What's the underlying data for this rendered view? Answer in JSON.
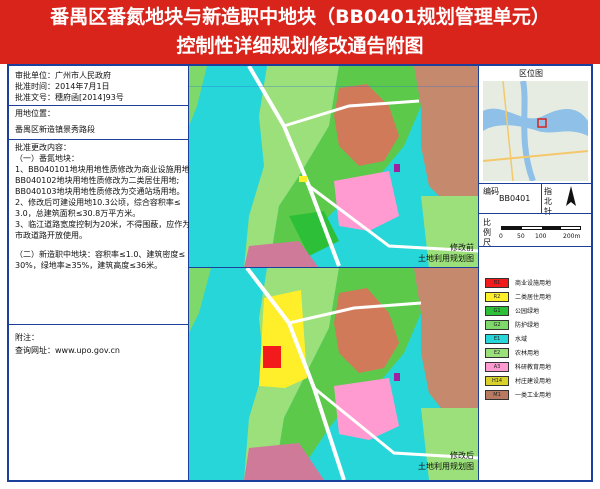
{
  "header": {
    "title_line1": "番禺区番氮地块与新造职中地块（BB0401规划管理单元）",
    "title_line2": "控制性详细规划修改通告附图"
  },
  "approval": {
    "unit": "审批单位：广州市人民政府",
    "date": "批准时间：2014年7月1日",
    "doc": "批准文号：穗府函[2014]93号"
  },
  "location": {
    "label": "用地位置：",
    "value": "番禺区新造镇景秀路段"
  },
  "changes": {
    "heading": "批准更改内容：",
    "sub1": "（一）番氮地块：",
    "lines": [
      "1、BB040101地块用地性质修改为商业设施用地;",
      "BB040102地块用地性质修改为二类居住用地;",
      "BB040103地块用地性质修改为交通站场用地。",
      "2、修改后可建设用地10.3公顷，综合容积率≤",
      "3.0，总建筑面积≤30.8万平方米。",
      "3、临江道路宽度控制为20米，不得围蔽，应作为",
      "市政道路开放使用。"
    ],
    "sub2_lines": [
      "（二）新造职中地块：容积率≤1.0、建筑密度≤",
      "30%，绿地率≥35%，建筑高度≤36米。"
    ]
  },
  "notes": {
    "label": "附注：",
    "website": "查询网址：www.upo.gov.cn"
  },
  "maps": {
    "before_label_1": "修改前",
    "before_label_2": "土地利用规划图",
    "after_label_1": "修改后",
    "after_label_2": "土地利用规划图"
  },
  "sidebar": {
    "region_label": "区位图",
    "code_label": "编码",
    "code_value": "BB0401",
    "north_label": "指北针",
    "scale_label": "比例尺",
    "scale_ticks": [
      "0",
      "50",
      "100",
      "200m"
    ]
  },
  "legend": [
    {
      "code": "B1",
      "label": "商业设施用地",
      "color": "#f21a1a"
    },
    {
      "code": "R2",
      "label": "二类居住用地",
      "color": "#ffef2b"
    },
    {
      "code": "G1",
      "label": "公园绿地",
      "color": "#2dbf38"
    },
    {
      "code": "G2",
      "label": "防护绿地",
      "color": "#7fd86a"
    },
    {
      "code": "E1",
      "label": "水域",
      "color": "#27d6d8"
    },
    {
      "code": "E2",
      "label": "农林用地",
      "color": "#9be07a"
    },
    {
      "code": "A3",
      "label": "科研教育用地",
      "color": "#ff9bd0"
    },
    {
      "code": "H14",
      "label": "村庄建设用地",
      "color": "#d9d22a"
    },
    {
      "code": "M1",
      "label": "一类工业用地",
      "color": "#b87a60"
    }
  ]
}
